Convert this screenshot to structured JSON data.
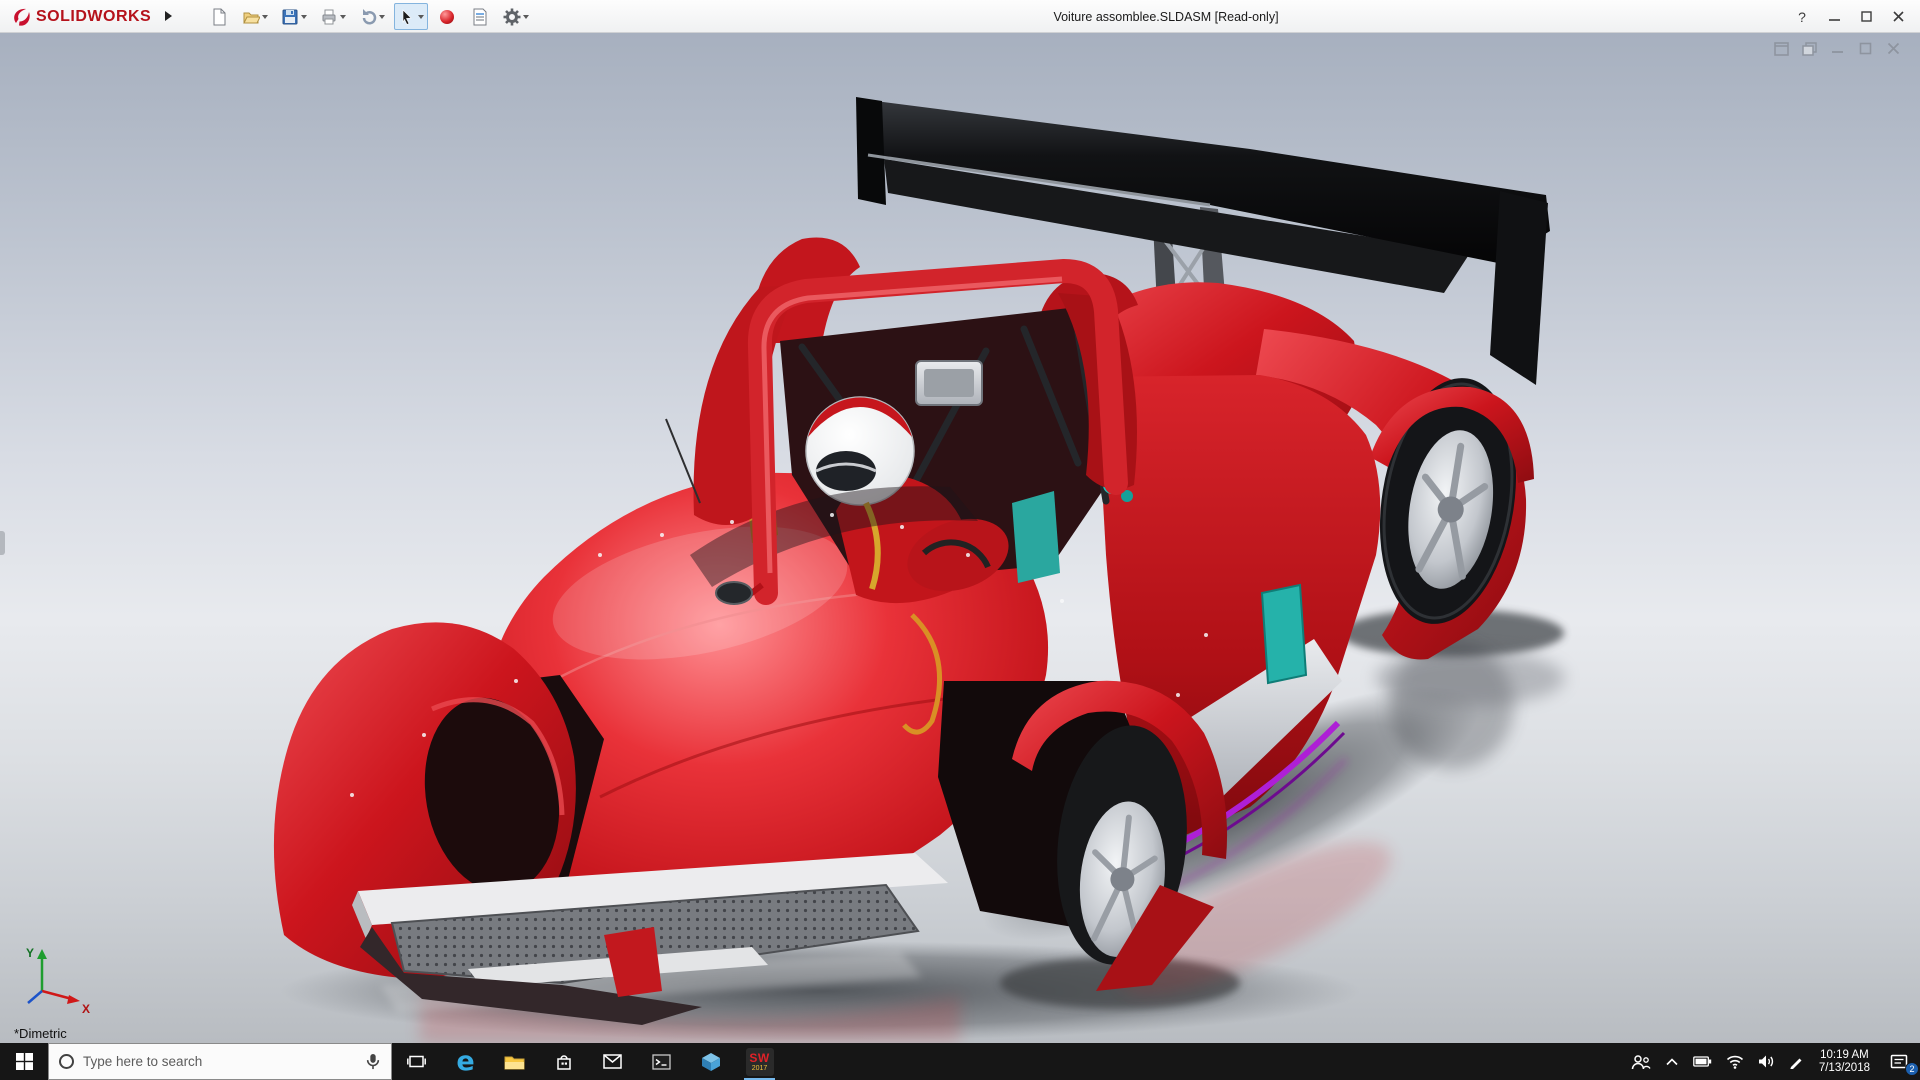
{
  "titlebar": {
    "logo_text": "SOLIDWORKS",
    "title": "Voiture assomblee.SLDASM [Read-only]",
    "help_label": "?",
    "tool_icons": [
      "new-document",
      "open",
      "save",
      "print",
      "undo",
      "select-cursor",
      "render-sphere",
      "file-properties",
      "options-gear"
    ]
  },
  "viewport": {
    "view_name": "*Dimetric",
    "triad": {
      "x_label": "X",
      "y_label": "Y"
    },
    "doc_control_icons": [
      "new-window",
      "cascade-windows",
      "minimize-doc",
      "restore-doc",
      "close-doc"
    ]
  },
  "taskbar": {
    "search_placeholder": "Type here to search",
    "edge_letter": "e",
    "solidworks_tile": {
      "line1": "SW",
      "line2": "2017"
    },
    "app_icons": [
      "start",
      "task-view",
      "edge",
      "file-explorer",
      "store",
      "mail",
      "console",
      "cad-viewer",
      "solidworks-2017"
    ],
    "tray": {
      "time": "10:19 AM",
      "date": "7/13/2018",
      "notification_badge": "2",
      "icons": [
        "people",
        "hidden-icons-chevron",
        "battery",
        "network",
        "volume",
        "pen-input",
        "action-center"
      ]
    }
  },
  "colors": {
    "body_red": "#cc151d",
    "wing_black": "#0c0d0e",
    "accent_purple": "#ae1fd6",
    "accent_teal": "#25b2aa",
    "taskbar_bg": "#161616",
    "viewport_top": "#a8b1c0",
    "viewport_bottom": "#b9bdc2"
  }
}
